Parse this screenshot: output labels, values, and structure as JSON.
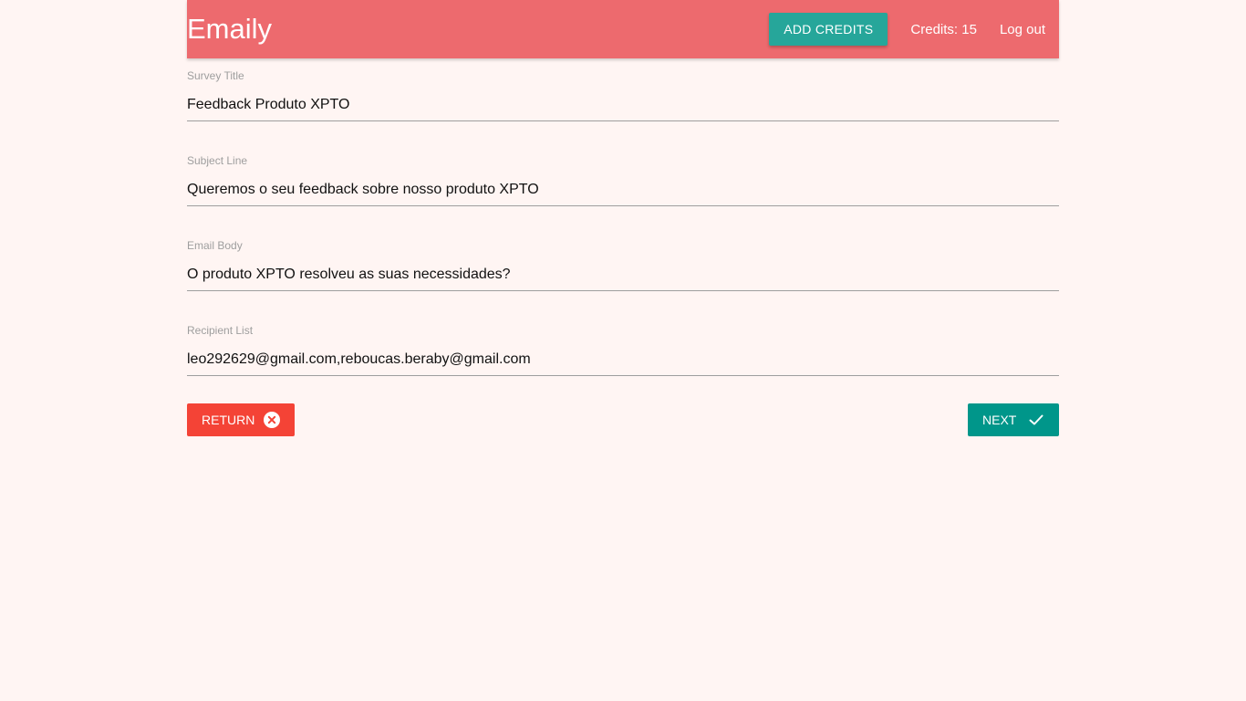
{
  "navbar": {
    "brand": "Emaily",
    "add_credits_label": "ADD CREDITS",
    "credits_text": "Credits: 15",
    "logout_label": "Log out",
    "color": "#ed6a6e"
  },
  "form": {
    "fields": [
      {
        "label": "Survey Title",
        "value": "Feedback Produto XPTO"
      },
      {
        "label": "Subject Line",
        "value": "Queremos o seu feedback sobre nosso produto XPTO"
      },
      {
        "label": "Email Body",
        "value": "O produto XPTO resolveu as suas necessidades?"
      },
      {
        "label": "Recipient List",
        "value": "leo292629@gmail.com,reboucas.beraby@gmail.com"
      }
    ]
  },
  "actions": {
    "return_label": "RETURN",
    "return_icon": "cancel-icon",
    "next_label": "NEXT",
    "next_icon": "check-icon"
  }
}
